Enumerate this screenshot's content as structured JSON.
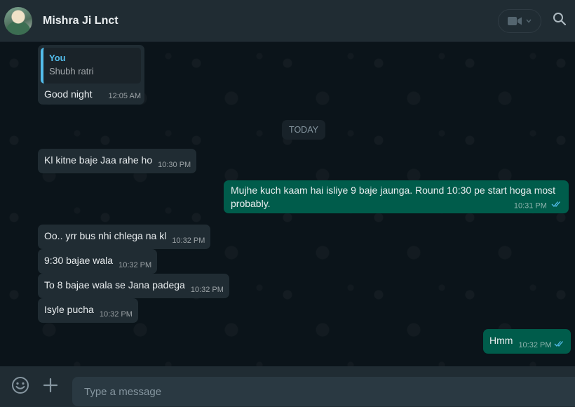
{
  "header": {
    "contact_name": "Mishra Ji Lnct",
    "avatar_icon": "avatar-icon",
    "video_icon": "video-camera-icon",
    "search_icon": "search-icon"
  },
  "chat": {
    "date_divider": "TODAY",
    "messages": [
      {
        "direction": "incoming",
        "quote_author": "You",
        "quote_text": "Shubh ratri",
        "text": "Good night",
        "time": "12:05 AM"
      },
      {
        "direction": "incoming",
        "text": "Kl kitne baje Jaa rahe ho",
        "time": "10:30 PM"
      },
      {
        "direction": "outgoing",
        "text_line1": "Mujhe kuch kaam hai isliye 9 baje jaunga. Round 10:30 pe start hoga most",
        "text_line2": "probably.",
        "time": "10:31 PM",
        "status": "read"
      },
      {
        "direction": "incoming",
        "text": "Oo.. yrr bus nhi chlega na kl",
        "time": "10:32 PM"
      },
      {
        "direction": "incoming",
        "text": "9:30 bajae wala",
        "time": "10:32 PM"
      },
      {
        "direction": "incoming",
        "text": "To 8 bajae wala se Jana padega",
        "time": "10:32 PM"
      },
      {
        "direction": "incoming",
        "text": "Isyle pucha",
        "time": "10:32 PM"
      },
      {
        "direction": "outgoing",
        "text": "Hmm",
        "time": "10:32 PM",
        "status": "read"
      }
    ]
  },
  "composer": {
    "placeholder": "Type a message",
    "emoji_icon": "emoji-icon",
    "attach_icon": "plus-icon"
  },
  "colors": {
    "header_bg": "#202c33",
    "chat_bg": "#0b141a",
    "incoming_bubble": "#202c33",
    "outgoing_bubble": "#005c4b",
    "read_tick": "#53bdeb",
    "quote_accent": "#53bdeb"
  }
}
